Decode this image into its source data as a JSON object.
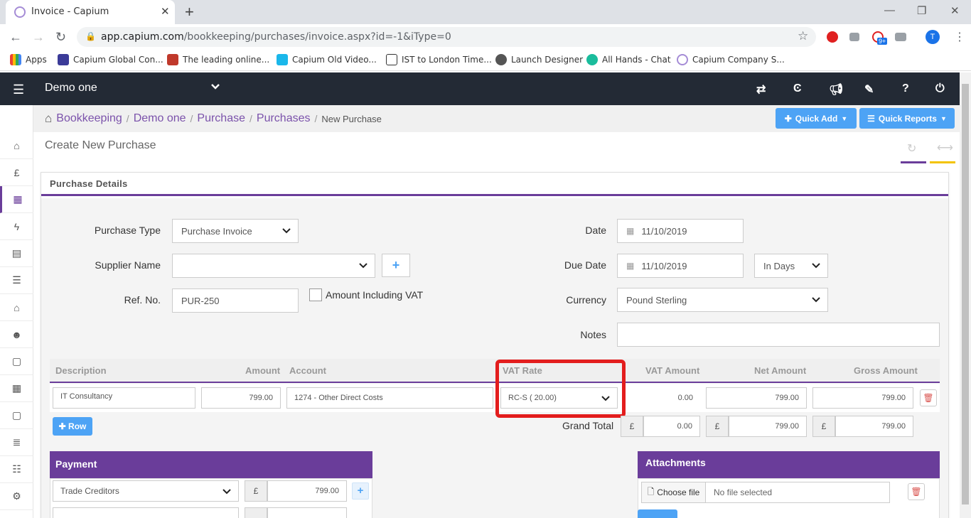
{
  "browser": {
    "tab_title": "Invoice - Capium",
    "tab_close": "✕",
    "new_tab": "+",
    "url_host": "app.capium.com",
    "url_path": "/bookkeeping/purchases/invoice.aspx?id=-1&iType=0",
    "profile_initial": "T",
    "window_controls": [
      "—",
      "❐",
      "✕"
    ],
    "bookmarks": [
      "Apps",
      "Capium Global Con...",
      "The leading online...",
      "Capium Old Video...",
      "IST to London Time...",
      "Launch Designer",
      "All Hands - Chat",
      "Capium Company S..."
    ],
    "ext_badge": "9+"
  },
  "header": {
    "company": "Demo one",
    "icons": [
      "swap-icon",
      "capium-logo-icon",
      "megaphone-icon",
      "ticket-icon",
      "help-icon",
      "power-icon"
    ]
  },
  "sidebar": {
    "icons": [
      "home-icon",
      "pound-icon",
      "dashboard-icon",
      "bolt-icon",
      "document-icon",
      "list-icon",
      "bank-icon",
      "users-icon",
      "calendar-icon",
      "calculator-icon",
      "calendar2-icon",
      "indent-icon",
      "table-icon",
      "cogs-icon"
    ]
  },
  "breadcrumb": {
    "items": [
      "Bookkeeping",
      "Demo one",
      "Purchase",
      "Purchases"
    ],
    "current": "New Purchase",
    "quick_add": "Quick Add",
    "quick_reports": "Quick Reports"
  },
  "page": {
    "title": "Create New Purchase"
  },
  "purchase_details": {
    "heading": "Purchase Details",
    "purchase_type_label": "Purchase Type",
    "purchase_type_value": "Purchase Invoice",
    "supplier_label": "Supplier Name",
    "supplier_value": "",
    "ref_label": "Ref. No.",
    "ref_value": "PUR-250",
    "amount_incl_vat_label": "Amount Including VAT",
    "date_label": "Date",
    "date_value": "11/10/2019",
    "due_date_label": "Due Date",
    "due_date_value": "11/10/2019",
    "due_in_value": "In Days",
    "currency_label": "Currency",
    "currency_value": "Pound Sterling",
    "notes_label": "Notes",
    "notes_value": ""
  },
  "line_items": {
    "headers": [
      "Description",
      "Amount",
      "Account",
      "VAT Rate",
      "VAT Amount",
      "Net Amount",
      "Gross Amount"
    ],
    "row": {
      "description": "IT Consultancy",
      "amount": "799.00",
      "account": "1274 - Other Direct Costs",
      "vat_rate": "RC-S ( 20.00)",
      "vat_amount": "0.00",
      "net_amount": "799.00",
      "gross_amount": "799.00"
    },
    "add_row": "Row",
    "grand_total_label": "Grand Total",
    "currency_symbol": "£",
    "total_vat": "0.00",
    "total_net": "799.00",
    "total_gross": "799.00",
    "highlight_color": "#e31d1d"
  },
  "payment": {
    "heading": "Payment",
    "account": "Trade Creditors",
    "currency_symbol": "£",
    "amount": "799.00"
  },
  "attachments": {
    "heading": "Attachments",
    "choose_file": "Choose file",
    "no_file": "No file selected"
  },
  "colors": {
    "accent_purple": "#6a3d9a",
    "button_blue": "#4da3f5",
    "header_dark": "#232a35"
  }
}
